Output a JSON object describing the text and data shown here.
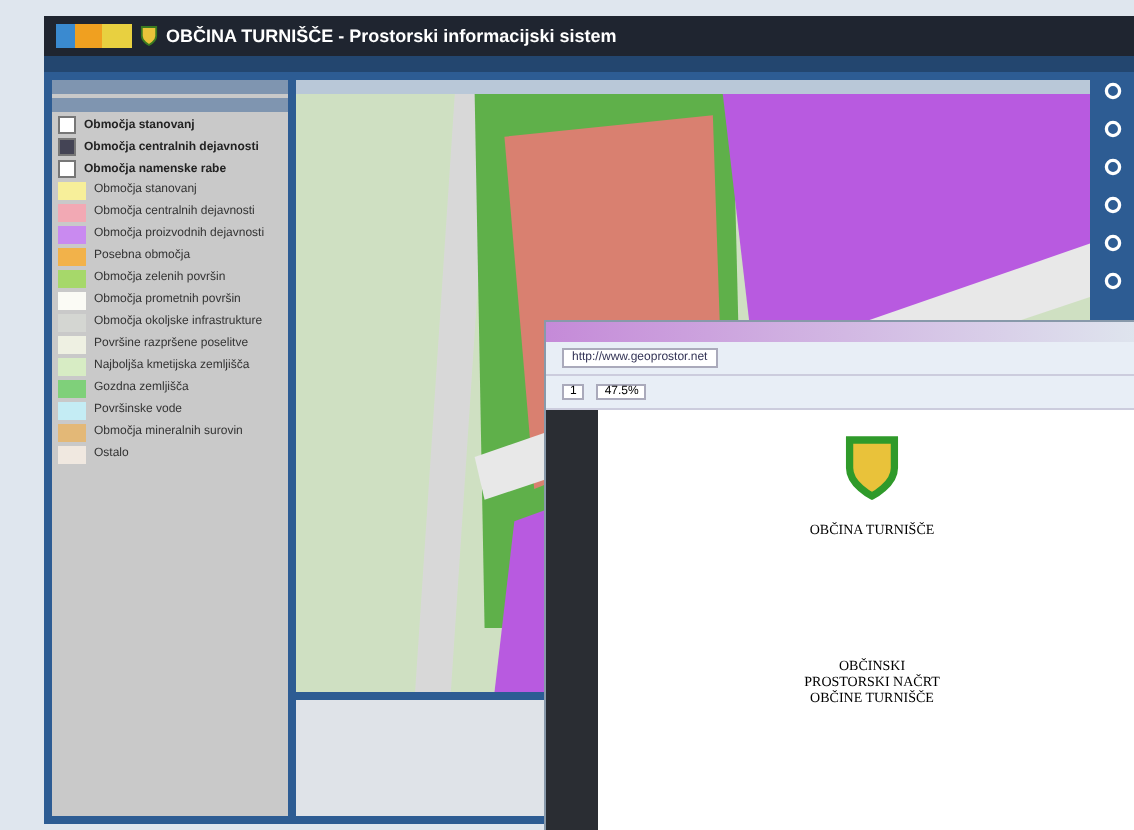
{
  "app": {
    "title": "OBČINA TURNIŠČE - Prostorski informacijski sistem"
  },
  "legend": {
    "layers": [
      {
        "label": "Območja stanovanj",
        "checked": false
      },
      {
        "label": "Območja centralnih dejavnosti",
        "checked": true
      },
      {
        "label": "Območja namenske rabe",
        "checked": false
      }
    ],
    "items": [
      {
        "label": "Območja stanovanj",
        "color": "#f7ef9a"
      },
      {
        "label": "Območja centralnih dejavnosti",
        "color": "#f2a9b4"
      },
      {
        "label": "Območja proizvodnih dejavnosti",
        "color": "#c98af0"
      },
      {
        "label": "Posebna območja",
        "color": "#f2b24a"
      },
      {
        "label": "Območja zelenih površin",
        "color": "#a6d86a"
      },
      {
        "label": "Območja prometnih površin",
        "color": "#fbfbf5"
      },
      {
        "label": "Območja okoljske infrastrukture",
        "color": "#d4d6d2"
      },
      {
        "label": "Površine razpršene poselitve",
        "color": "#eef0e2"
      },
      {
        "label": "Najboljša kmetijska zemljišča",
        "color": "#d7ecc4"
      },
      {
        "label": "Gozdna zemljišča",
        "color": "#7fd07a"
      },
      {
        "label": "Površinske vode",
        "color": "#c4ecf4"
      },
      {
        "label": "Območja mineralnih surovin",
        "color": "#e3b877"
      },
      {
        "label": "Ostalo",
        "color": "#f0e8e0"
      }
    ]
  },
  "browser": {
    "url": "http://www.geoprostor.net",
    "page": "1",
    "zoom": "47.5%"
  },
  "document": {
    "municipality": "OBČINA TURNIŠČE",
    "heading": "OBČINSKI\nPROSTORSKI NAČRT\nOBČINE TURNIŠČE"
  }
}
